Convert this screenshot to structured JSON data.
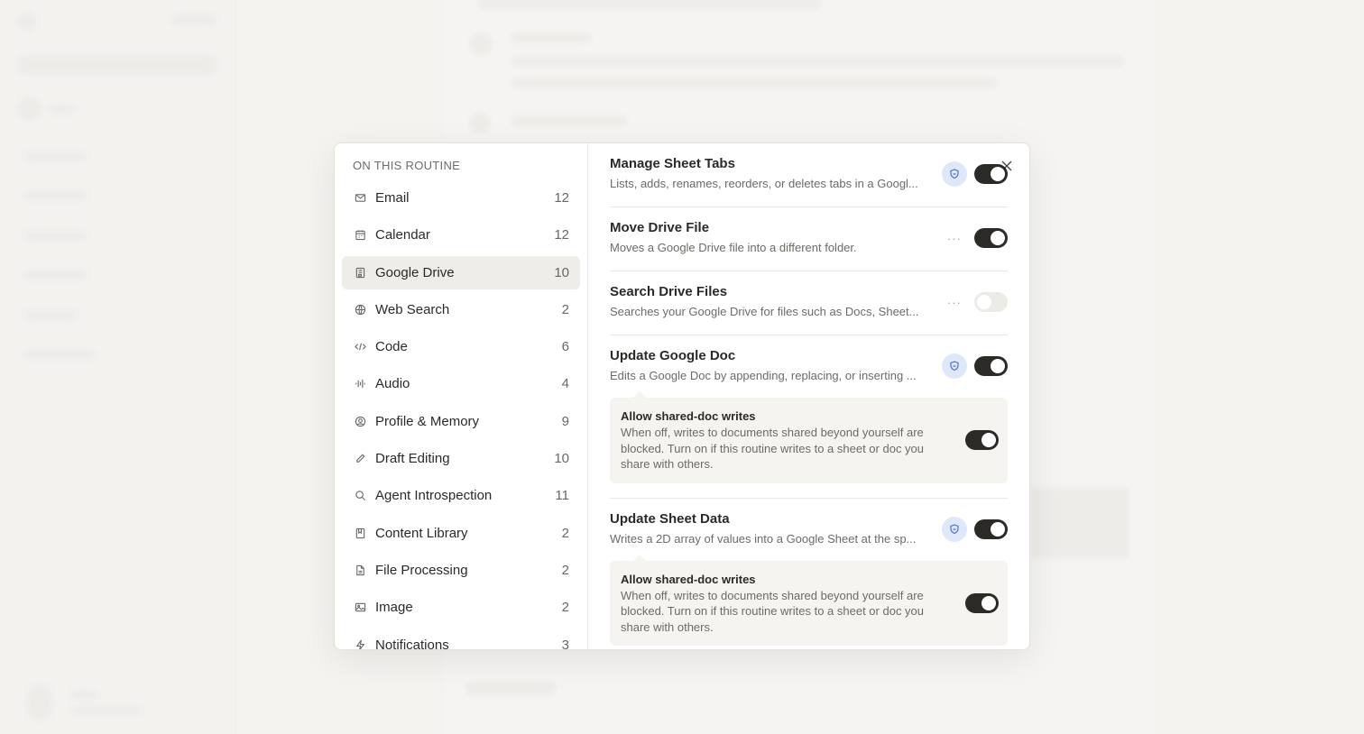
{
  "nav": {
    "heading": "ON THIS ROUTINE",
    "items": [
      {
        "label": "Email",
        "count": "12",
        "icon": "mail-icon"
      },
      {
        "label": "Calendar",
        "count": "12",
        "icon": "calendar-icon"
      },
      {
        "label": "Google Drive",
        "count": "10",
        "icon": "drive-icon"
      },
      {
        "label": "Web Search",
        "count": "2",
        "icon": "globe-icon"
      },
      {
        "label": "Code",
        "count": "6",
        "icon": "code-icon"
      },
      {
        "label": "Audio",
        "count": "4",
        "icon": "audio-icon"
      },
      {
        "label": "Profile & Memory",
        "count": "9",
        "icon": "profile-icon"
      },
      {
        "label": "Draft Editing",
        "count": "10",
        "icon": "pencil-icon"
      },
      {
        "label": "Agent Introspection",
        "count": "11",
        "icon": "search-icon"
      },
      {
        "label": "Content Library",
        "count": "2",
        "icon": "bookmark-icon"
      },
      {
        "label": "File Processing",
        "count": "2",
        "icon": "file-icon"
      },
      {
        "label": "Image",
        "count": "2",
        "icon": "image-icon"
      },
      {
        "label": "Notifications",
        "count": "3",
        "icon": "bolt-icon"
      }
    ],
    "active_index": 2
  },
  "tools": [
    {
      "title": "Manage Sheet Tabs",
      "desc": "Lists, adds, renames, reorders, or deletes tabs in a Googl...",
      "badge": "shield-icon",
      "enabled": true
    },
    {
      "title": "Move Drive File",
      "desc": "Moves a Google Drive file into a different folder.",
      "badge": "more-icon",
      "enabled": true
    },
    {
      "title": "Search Drive Files",
      "desc": "Searches your Google Drive for files such as Docs, Sheet...",
      "badge": "more-icon",
      "enabled": false
    },
    {
      "title": "Update Google Doc",
      "desc": "Edits a Google Doc by appending, replacing, or inserting ...",
      "badge": "shield-icon",
      "enabled": true,
      "sub": {
        "title": "Allow shared-doc writes",
        "desc": "When off, writes to documents shared beyond yourself are blocked. Turn on if this routine writes to a sheet or doc you share with others.",
        "enabled": true
      }
    },
    {
      "title": "Update Sheet Data",
      "desc": "Writes a 2D array of values into a Google Sheet at the sp...",
      "badge": "shield-icon",
      "enabled": true,
      "sub": {
        "title": "Allow shared-doc writes",
        "desc": "When off, writes to documents shared beyond yourself are blocked. Turn on if this routine writes to a sheet or doc you share with others.",
        "enabled": true
      }
    }
  ],
  "more_label": "···",
  "colors": {
    "toggle_on": "#2b2a27",
    "toggle_off": "#ecebe8",
    "shield_bg": "#dfe8fb",
    "shield_fg": "#4a6fc7"
  }
}
